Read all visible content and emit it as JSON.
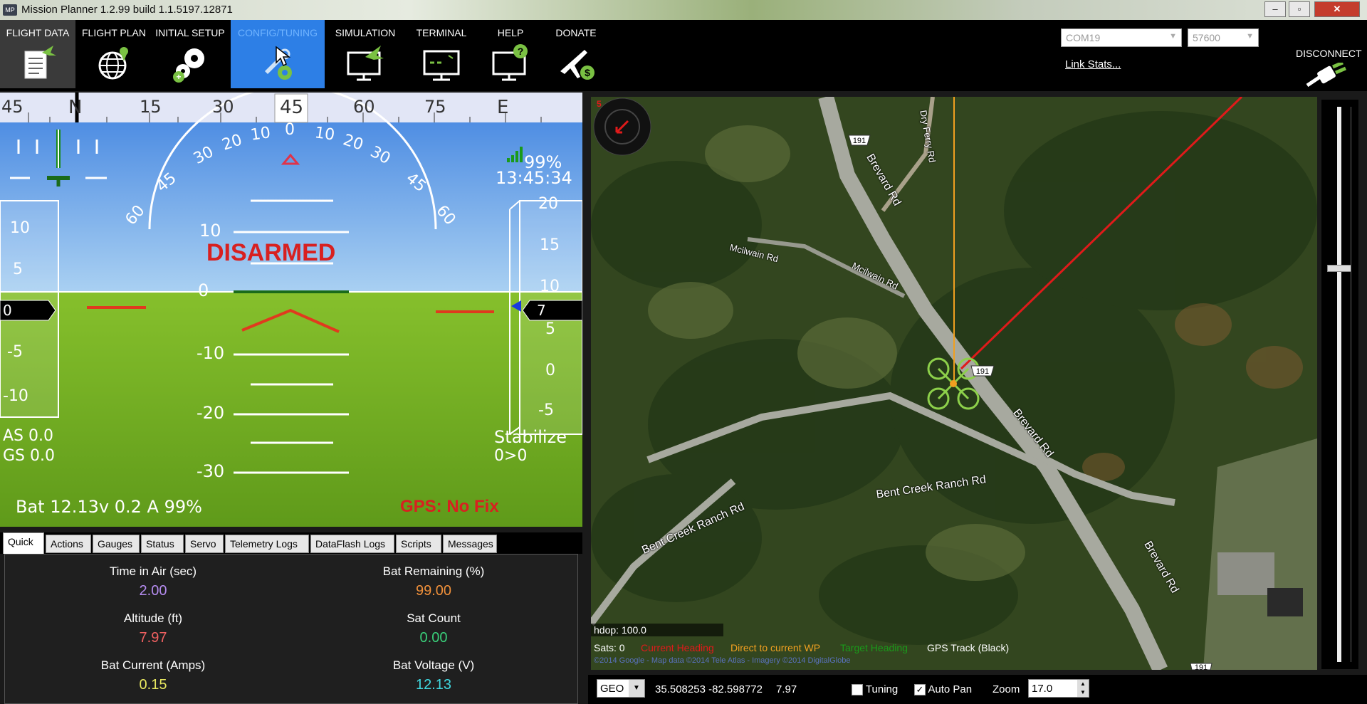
{
  "window": {
    "title": "Mission Planner 1.2.99 build 1.1.5197.12871",
    "icon_label": "MP",
    "min": "–",
    "max": "▫",
    "close": "✕"
  },
  "toolbar": {
    "items": [
      {
        "label": "FLIGHT DATA",
        "icon": "flight-data-icon"
      },
      {
        "label": "FLIGHT PLAN",
        "icon": "globe-pin-icon"
      },
      {
        "label": "INITIAL SETUP",
        "icon": "gears-icon"
      },
      {
        "label": "CONFIG/TUNING",
        "icon": "config-gear-icon"
      },
      {
        "label": "SIMULATION",
        "icon": "monitor-plane-icon"
      },
      {
        "label": "TERMINAL",
        "icon": "terminal-monitor-icon"
      },
      {
        "label": "HELP",
        "icon": "monitor-question-icon"
      },
      {
        "label": "DONATE",
        "icon": "plane-dollar-icon"
      }
    ],
    "com_port": "COM19",
    "baud": "57600",
    "link_stats": "Link Stats...",
    "disconnect": "DISCONNECT",
    "accent": "#2d7fe6"
  },
  "hud": {
    "heading_ticks": [
      "45",
      "N",
      "15",
      "30",
      "45",
      "60",
      "75",
      "E"
    ],
    "heading_current": "45",
    "roll_labels": [
      "60",
      "45",
      "30",
      "20",
      "10",
      "0",
      "10",
      "20",
      "30",
      "45",
      "60"
    ],
    "pitch_labels": [
      "10",
      "0",
      "-10",
      "-20",
      "-30"
    ],
    "speed_ticks": [
      "10",
      "5",
      "0",
      "-5",
      "-10"
    ],
    "alt_ticks": [
      "20",
      "15",
      "10",
      "5",
      "0",
      "-5"
    ],
    "speed_value": "0",
    "alt_value": "7",
    "status": "DISARMED",
    "link_quality": "99%",
    "time": "13:45:34",
    "airspeed": "AS 0.0",
    "groundspeed": "GS 0.0",
    "mode": "Stabilize",
    "waypoint": "0>0",
    "battery": "Bat 12.13v 0.2 A 99%",
    "gps": "GPS: No Fix",
    "sky_color": "#6aa8e8",
    "ground_color": "#7fb82a"
  },
  "tabs": [
    "Quick",
    "Actions",
    "Gauges",
    "Status",
    "Servo",
    "Telemetry Logs",
    "DataFlash Logs",
    "Scripts",
    "Messages"
  ],
  "quick": [
    {
      "label": "Time in Air (sec)",
      "value": "2.00",
      "color": "#b58cf0"
    },
    {
      "label": "Bat Remaining (%)",
      "value": "99.00",
      "color": "#f0903a"
    },
    {
      "label": "Altitude (ft)",
      "value": "7.97",
      "color": "#f06060"
    },
    {
      "label": "Sat Count",
      "value": "0.00",
      "color": "#3ad07a"
    },
    {
      "label": "Bat Current (Amps)",
      "value": "0.15",
      "color": "#e8e860"
    },
    {
      "label": "Bat Voltage (V)",
      "value": "12.13",
      "color": "#40d8e0"
    }
  ],
  "map": {
    "roads": [
      "Brevard Rd",
      "Brevard Rd",
      "Brevard Rd",
      "Dry Ferry Rd",
      "Mcilwain Rd",
      "Mcilwain Rd",
      "Bent Creek Ranch Rd",
      "Bent Creek Ranch Rd"
    ],
    "route_shields": [
      "191",
      "191",
      "191"
    ],
    "compass_number": "5",
    "hdop": "hdop: 100.0",
    "legend": {
      "sats": "Sats: 0",
      "current_heading": "Current Heading",
      "direct_wp": "Direct to current WP",
      "target_heading": "Target Heading",
      "gps_track": "GPS Track (Black)"
    },
    "copyright": "©2014 Google - Map data ©2014 Tele Atlas - Imagery ©2014 DigitalGlobe"
  },
  "bottombar": {
    "coord_system": "GEO",
    "coords": "35.508253 -82.598772",
    "alt": "7.97",
    "tuning_label": "Tuning",
    "tuning_checked": "",
    "autopan_label": "Auto Pan",
    "autopan_checked": "✓",
    "zoom_label": "Zoom",
    "zoom_value": "17.0"
  }
}
